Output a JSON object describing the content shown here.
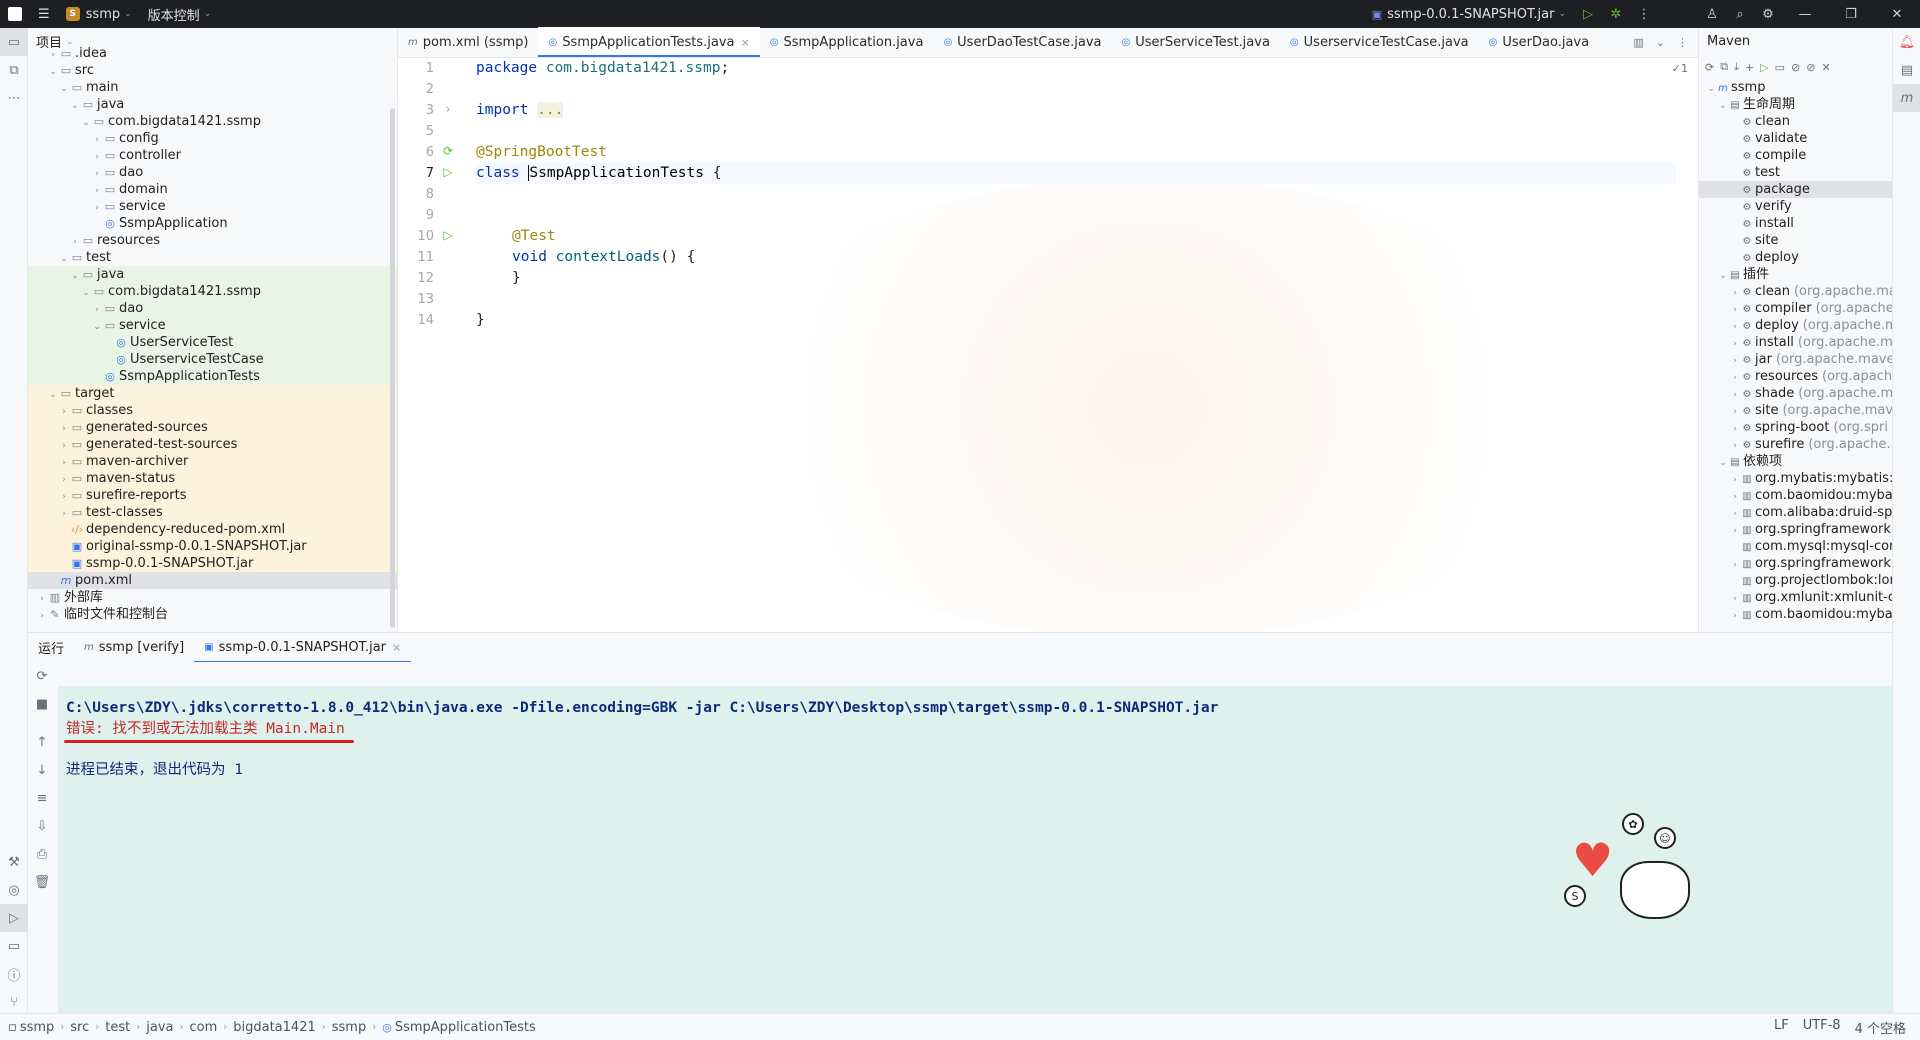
{
  "titlebar": {
    "project_name": "ssmp",
    "project_badge": "S",
    "vcs_label": "版本控制",
    "run_config": "ssmp-0.0.1-SNAPSHOT.jar"
  },
  "project_panel": {
    "title": "项目",
    "rows": [
      {
        "label": ".idea",
        "indent": 1,
        "arrow": "›",
        "icon": "folder",
        "bg": ""
      },
      {
        "label": "src",
        "indent": 1,
        "arrow": "⌄",
        "icon": "folder",
        "bg": ""
      },
      {
        "label": "main",
        "indent": 2,
        "arrow": "⌄",
        "icon": "folder",
        "bg": ""
      },
      {
        "label": "java",
        "indent": 3,
        "arrow": "⌄",
        "icon": "folder",
        "bg": ""
      },
      {
        "label": "com.bigdata1421.ssmp",
        "indent": 4,
        "arrow": "⌄",
        "icon": "package",
        "bg": ""
      },
      {
        "label": "config",
        "indent": 5,
        "arrow": "›",
        "icon": "package",
        "bg": ""
      },
      {
        "label": "controller",
        "indent": 5,
        "arrow": "›",
        "icon": "package",
        "bg": ""
      },
      {
        "label": "dao",
        "indent": 5,
        "arrow": "›",
        "icon": "package",
        "bg": ""
      },
      {
        "label": "domain",
        "indent": 5,
        "arrow": "›",
        "icon": "package",
        "bg": ""
      },
      {
        "label": "service",
        "indent": 5,
        "arrow": "›",
        "icon": "package",
        "bg": ""
      },
      {
        "label": "SsmpApplication",
        "indent": 5,
        "arrow": "",
        "icon": "class",
        "bg": ""
      },
      {
        "label": "resources",
        "indent": 3,
        "arrow": "›",
        "icon": "folder",
        "bg": ""
      },
      {
        "label": "test",
        "indent": 2,
        "arrow": "⌄",
        "icon": "folder",
        "bg": ""
      },
      {
        "label": "java",
        "indent": 3,
        "arrow": "⌄",
        "icon": "folder",
        "bg": "green"
      },
      {
        "label": "com.bigdata1421.ssmp",
        "indent": 4,
        "arrow": "⌄",
        "icon": "package",
        "bg": "green"
      },
      {
        "label": "dao",
        "indent": 5,
        "arrow": "›",
        "icon": "package",
        "bg": "green"
      },
      {
        "label": "service",
        "indent": 5,
        "arrow": "⌄",
        "icon": "package",
        "bg": "green"
      },
      {
        "label": "UserServiceTest",
        "indent": 6,
        "arrow": "",
        "icon": "class",
        "bg": "green"
      },
      {
        "label": "UserserviceTestCase",
        "indent": 6,
        "arrow": "",
        "icon": "class",
        "bg": "green"
      },
      {
        "label": "SsmpApplicationTests",
        "indent": 5,
        "arrow": "",
        "icon": "class",
        "bg": "green"
      },
      {
        "label": "target",
        "indent": 1,
        "arrow": "⌄",
        "icon": "folder",
        "bg": "orange"
      },
      {
        "label": "classes",
        "indent": 2,
        "arrow": "›",
        "icon": "folder",
        "bg": "orange"
      },
      {
        "label": "generated-sources",
        "indent": 2,
        "arrow": "›",
        "icon": "folder",
        "bg": "orange"
      },
      {
        "label": "generated-test-sources",
        "indent": 2,
        "arrow": "›",
        "icon": "folder",
        "bg": "orange"
      },
      {
        "label": "maven-archiver",
        "indent": 2,
        "arrow": "›",
        "icon": "folder",
        "bg": "orange"
      },
      {
        "label": "maven-status",
        "indent": 2,
        "arrow": "›",
        "icon": "folder",
        "bg": "orange"
      },
      {
        "label": "surefire-reports",
        "indent": 2,
        "arrow": "›",
        "icon": "folder",
        "bg": "orange"
      },
      {
        "label": "test-classes",
        "indent": 2,
        "arrow": "›",
        "icon": "folder",
        "bg": "orange"
      },
      {
        "label": "dependency-reduced-pom.xml",
        "indent": 2,
        "arrow": "",
        "icon": "xml",
        "bg": "orange"
      },
      {
        "label": "original-ssmp-0.0.1-SNAPSHOT.jar",
        "indent": 2,
        "arrow": "",
        "icon": "jar",
        "bg": "orange"
      },
      {
        "label": "ssmp-0.0.1-SNAPSHOT.jar",
        "indent": 2,
        "arrow": "",
        "icon": "jar",
        "bg": "orange"
      },
      {
        "label": "pom.xml",
        "indent": 1,
        "arrow": "",
        "icon": "maven",
        "bg": "sel"
      },
      {
        "label": "外部库",
        "indent": 0,
        "arrow": "›",
        "icon": "library",
        "bg": ""
      },
      {
        "label": "临时文件和控制台",
        "indent": 0,
        "arrow": "›",
        "icon": "scratch",
        "bg": ""
      }
    ]
  },
  "editor_tabs": [
    {
      "label": "pom.xml (ssmp)",
      "icon": "m",
      "active": false
    },
    {
      "label": "SsmpApplicationTests.java",
      "icon": "◎",
      "active": true
    },
    {
      "label": "SsmpApplication.java",
      "icon": "◎",
      "active": false
    },
    {
      "label": "UserDaoTestCase.java",
      "icon": "◎",
      "active": false
    },
    {
      "label": "UserServiceTest.java",
      "icon": "◎",
      "active": false
    },
    {
      "label": "UserserviceTestCase.java",
      "icon": "◎",
      "active": false
    },
    {
      "label": "UserDao.java",
      "icon": "◎",
      "active": false
    }
  ],
  "editor": {
    "badge": "✓1",
    "line_numbers": [
      "1",
      "2",
      "3",
      "5",
      "6",
      "7",
      "8",
      "9",
      "10",
      "11",
      "12",
      "13",
      "14"
    ],
    "code": {
      "l1_kw": "package",
      "l1_pkg": "com.bigdata1421.ssmp",
      "l1_semi": ";",
      "l3_kw": "import",
      "l3_fold": "...",
      "l6_ann": "@SpringBootTest",
      "l7_kw": "class",
      "l7_name": "SsmpApplicationTests",
      "l7_brace": "{",
      "l9_ann": "@Test",
      "l10_kw": "void",
      "l10_fn": "contextLoads",
      "l10_rest": "() {",
      "l11": "}",
      "l13": "}"
    }
  },
  "maven": {
    "title": "Maven",
    "rows": [
      {
        "label": "ssmp",
        "grey": "",
        "indent": 0,
        "arrow": "⌄",
        "icon": "m",
        "sel": false
      },
      {
        "label": "生命周期",
        "grey": "",
        "indent": 1,
        "arrow": "⌄",
        "icon": "▤",
        "sel": false
      },
      {
        "label": "clean",
        "grey": "",
        "indent": 2,
        "arrow": "",
        "icon": "⚙",
        "sel": false
      },
      {
        "label": "validate",
        "grey": "",
        "indent": 2,
        "arrow": "",
        "icon": "⚙",
        "sel": false
      },
      {
        "label": "compile",
        "grey": "",
        "indent": 2,
        "arrow": "",
        "icon": "⚙",
        "sel": false
      },
      {
        "label": "test",
        "grey": "",
        "indent": 2,
        "arrow": "",
        "icon": "⚙",
        "sel": false
      },
      {
        "label": "package",
        "grey": "",
        "indent": 2,
        "arrow": "",
        "icon": "⚙",
        "sel": true
      },
      {
        "label": "verify",
        "grey": "",
        "indent": 2,
        "arrow": "",
        "icon": "⚙",
        "sel": false
      },
      {
        "label": "install",
        "grey": "",
        "indent": 2,
        "arrow": "",
        "icon": "⚙",
        "sel": false
      },
      {
        "label": "site",
        "grey": "",
        "indent": 2,
        "arrow": "",
        "icon": "⚙",
        "sel": false
      },
      {
        "label": "deploy",
        "grey": "",
        "indent": 2,
        "arrow": "",
        "icon": "⚙",
        "sel": false
      },
      {
        "label": "插件",
        "grey": "",
        "indent": 1,
        "arrow": "⌄",
        "icon": "▤",
        "sel": false
      },
      {
        "label": "clean",
        "grey": "(org.apache.ma",
        "indent": 2,
        "arrow": "›",
        "icon": "⚙",
        "sel": false
      },
      {
        "label": "compiler",
        "grey": "(org.apache",
        "indent": 2,
        "arrow": "›",
        "icon": "⚙",
        "sel": false
      },
      {
        "label": "deploy",
        "grey": "(org.apache.m",
        "indent": 2,
        "arrow": "›",
        "icon": "⚙",
        "sel": false
      },
      {
        "label": "install",
        "grey": "(org.apache.ma",
        "indent": 2,
        "arrow": "›",
        "icon": "⚙",
        "sel": false
      },
      {
        "label": "jar",
        "grey": "(org.apache.mave",
        "indent": 2,
        "arrow": "›",
        "icon": "⚙",
        "sel": false
      },
      {
        "label": "resources",
        "grey": "(org.apach",
        "indent": 2,
        "arrow": "›",
        "icon": "⚙",
        "sel": false
      },
      {
        "label": "shade",
        "grey": "(org.apache.m",
        "indent": 2,
        "arrow": "›",
        "icon": "⚙",
        "sel": false
      },
      {
        "label": "site",
        "grey": "(org.apache.mav",
        "indent": 2,
        "arrow": "›",
        "icon": "⚙",
        "sel": false
      },
      {
        "label": "spring-boot",
        "grey": "(org.spri",
        "indent": 2,
        "arrow": "›",
        "icon": "⚙",
        "sel": false
      },
      {
        "label": "surefire",
        "grey": "(org.apache.",
        "indent": 2,
        "arrow": "›",
        "icon": "⚙",
        "sel": false
      },
      {
        "label": "依赖项",
        "grey": "",
        "indent": 1,
        "arrow": "⌄",
        "icon": "▤",
        "sel": false
      },
      {
        "label": "org.mybatis:mybatis:",
        "grey": "",
        "indent": 2,
        "arrow": "›",
        "icon": "▥",
        "sel": false
      },
      {
        "label": "com.baomidou:mybat",
        "grey": "",
        "indent": 2,
        "arrow": "›",
        "icon": "▥",
        "sel": false
      },
      {
        "label": "com.alibaba:druid-spr",
        "grey": "",
        "indent": 2,
        "arrow": "›",
        "icon": "▥",
        "sel": false
      },
      {
        "label": "org.springframework",
        "grey": "",
        "indent": 2,
        "arrow": "›",
        "icon": "▥",
        "sel": false
      },
      {
        "label": "com.mysql:mysql-cor",
        "grey": "",
        "indent": 2,
        "arrow": "",
        "icon": "▥",
        "sel": false
      },
      {
        "label": "org.springframework",
        "grey": "",
        "indent": 2,
        "arrow": "›",
        "icon": "▥",
        "sel": false
      },
      {
        "label": "org.projectlombok:lor",
        "grey": "",
        "indent": 2,
        "arrow": "",
        "icon": "▥",
        "sel": false
      },
      {
        "label": "org.xmlunit:xmlunit-c",
        "grey": "",
        "indent": 2,
        "arrow": "›",
        "icon": "▥",
        "sel": false
      },
      {
        "label": "com.baomidou:mybat",
        "grey": "",
        "indent": 2,
        "arrow": "›",
        "icon": "▥",
        "sel": false
      }
    ]
  },
  "run_panel": {
    "title": "运行",
    "tabs": [
      {
        "label": "ssmp [verify]",
        "icon": "m",
        "active": false
      },
      {
        "label": "ssmp-0.0.1-SNAPSHOT.jar",
        "icon": "▣",
        "active": true
      }
    ],
    "console": {
      "command": "C:\\Users\\ZDY\\.jdks\\corretto-1.8.0_412\\bin\\java.exe -Dfile.encoding=GBK -jar C:\\Users\\ZDY\\Desktop\\ssmp\\target\\ssmp-0.0.1-SNAPSHOT.jar",
      "error": "错误: 找不到或无法加载主类 Main.Main",
      "exit": "进程已结束，退出代码为 1"
    }
  },
  "statusbar": {
    "breadcrumb": [
      "ssmp",
      "src",
      "test",
      "java",
      "com",
      "bigdata1421",
      "ssmp",
      "SsmpApplicationTests"
    ],
    "line_sep": "LF",
    "encoding": "UTF-8",
    "indent": "4 个空格"
  },
  "colors": {
    "accent": "#3574f0",
    "error_red": "#d92020",
    "console_bg": "#dff1ec",
    "titlebar_bg": "#1e1f22"
  }
}
